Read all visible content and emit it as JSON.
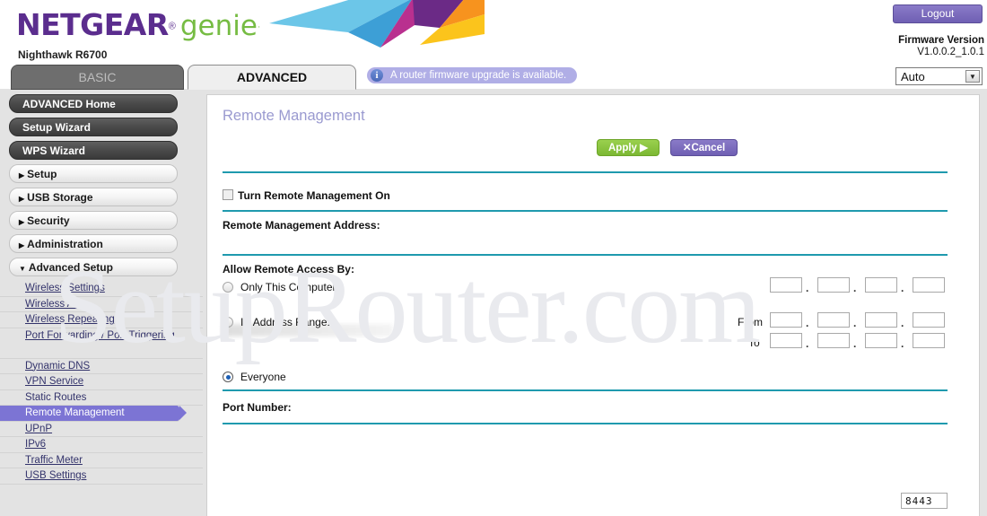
{
  "brand": {
    "netgear": "NETGEAR",
    "reg": "®",
    "genie": "genie",
    "genie_reg": "·",
    "model": "Nighthawk R6700"
  },
  "header": {
    "logout_label": "Logout",
    "firmware_label": "Firmware Version",
    "firmware_version": "V1.0.0.2_1.0.1",
    "language_selected": "Auto",
    "language_arrow": "▼"
  },
  "tabs": {
    "basic": "BASIC",
    "advanced": "ADVANCED",
    "firmware_notice": "A router firmware upgrade is available.",
    "info_glyph": "i"
  },
  "sidebar": {
    "buttons": [
      {
        "label": "ADVANCED Home",
        "style": "dark"
      },
      {
        "label": "Setup Wizard",
        "style": "dark"
      },
      {
        "label": "WPS Wizard",
        "style": "dark"
      },
      {
        "label": "Setup",
        "style": "light",
        "marker": "▶"
      },
      {
        "label": "USB Storage",
        "style": "light",
        "marker": "▶"
      },
      {
        "label": "Security",
        "style": "light",
        "marker": "▶"
      },
      {
        "label": "Administration",
        "style": "light",
        "marker": "▶"
      },
      {
        "label": "Advanced Setup",
        "style": "light",
        "marker": "▼"
      }
    ],
    "sub_items": [
      {
        "label": "Wireless Settings",
        "active": false
      },
      {
        "label": "Wireless AP",
        "active": false
      },
      {
        "label": "Wireless Repeating",
        "active": false
      },
      {
        "label": "Port Forwarding / Port Triggering",
        "active": false,
        "two_line": true
      },
      {
        "label": "Dynamic DNS",
        "active": false
      },
      {
        "label": "VPN Service",
        "active": false
      },
      {
        "label": "Static Routes",
        "active": false,
        "no_underline": true
      },
      {
        "label": "Remote Management",
        "active": true
      },
      {
        "label": "UPnP",
        "active": false
      },
      {
        "label": "IPv6",
        "active": false
      },
      {
        "label": "Traffic Meter",
        "active": false
      },
      {
        "label": "USB Settings",
        "active": false
      }
    ]
  },
  "main": {
    "title": "Remote Management",
    "apply_label": "Apply ▶",
    "cancel_label": "✕Cancel",
    "turn_on_label": "Turn Remote Management On",
    "turn_on_checked": false,
    "address_label": "Remote Management Address:",
    "address_value": "",
    "allow_label": "Allow Remote Access By:",
    "options": [
      {
        "label": "Only This Computer:",
        "selected": false
      },
      {
        "label": "IP Address Range:",
        "selected": false
      },
      {
        "label": "Everyone",
        "selected": true
      }
    ],
    "range_from_label": "From",
    "range_to_label": "To",
    "octet_separator": ".",
    "port_label": "Port Number:",
    "port_value": "8443"
  },
  "watermark": {
    "text": "SetupRouter.com"
  },
  "colors": {
    "netgear_purple": "#5b2d8e",
    "genie_green": "#76bc43",
    "accent_teal": "#1f9aae",
    "apply_green": "#7cb833",
    "cancel_purple": "#6f5fb3",
    "active_nav": "#7c74d4",
    "notice_purple": "#b0aee6"
  }
}
